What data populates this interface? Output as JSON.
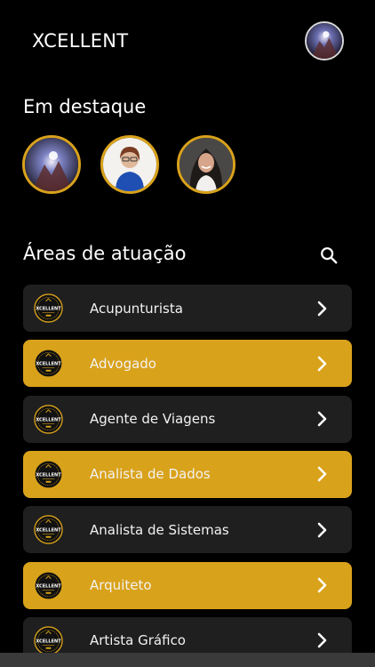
{
  "header": {
    "title": "XCELLENT",
    "avatar": "profile-avatar"
  },
  "featured": {
    "title": "Em destaque",
    "stories": [
      {
        "name": "featured-story-1"
      },
      {
        "name": "featured-story-2"
      },
      {
        "name": "featured-story-3"
      }
    ]
  },
  "areas": {
    "title": "Áreas de atuação",
    "search_icon": "search-icon",
    "items": [
      {
        "label": "Acupunturista",
        "style": "dark"
      },
      {
        "label": "Advogado",
        "style": "gold"
      },
      {
        "label": "Agente de Viagens",
        "style": "dark"
      },
      {
        "label": "Analista de Dados",
        "style": "gold"
      },
      {
        "label": "Analista de Sistemas",
        "style": "dark"
      },
      {
        "label": "Arquiteto",
        "style": "gold"
      },
      {
        "label": "Artista Gráfico",
        "style": "dark"
      }
    ]
  },
  "colors": {
    "accent": "#d9a21b",
    "row_dark": "#1f1f1f",
    "background": "#000000"
  },
  "logo_text": "XCELLENT"
}
